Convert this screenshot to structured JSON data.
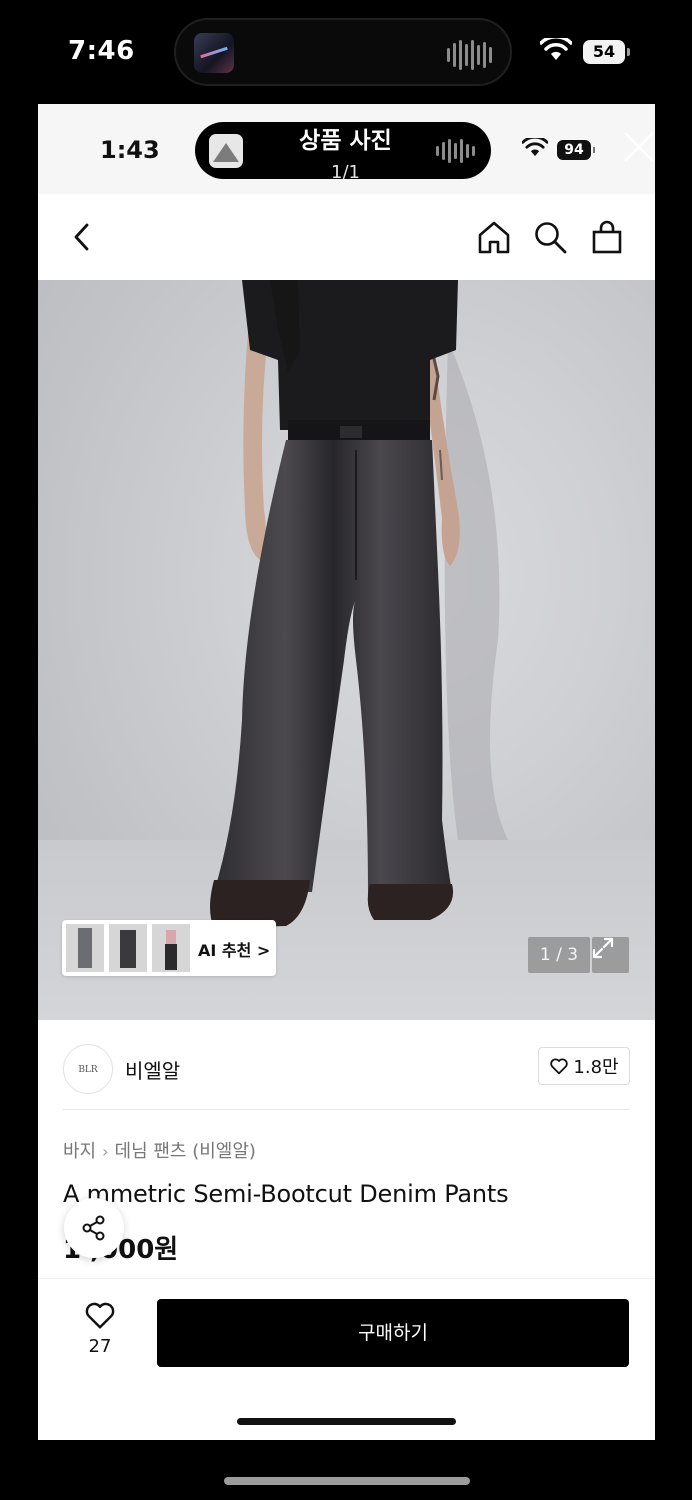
{
  "outer_status": {
    "time": "7:46",
    "battery": "54"
  },
  "inner_status": {
    "time": "1:43",
    "battery": "94"
  },
  "viewer": {
    "title": "상품 사진",
    "counter": "1/1"
  },
  "navbar": {
    "icons": [
      "back-icon",
      "home-icon",
      "search-icon",
      "shopping-bag-icon"
    ]
  },
  "image": {
    "ai_recommend_label": "AI 추천 >",
    "counter": "1 / 3"
  },
  "brand": {
    "logo_text": "BLR",
    "name": "비엘알",
    "likes": "1.8만"
  },
  "breadcrumb": {
    "category": "바지",
    "subcategory": "데님 팬츠 (비엘알)"
  },
  "product": {
    "name": "A  mmetric Semi-Bootcut Denim Pants",
    "price": "1  ,000원"
  },
  "bottom_bar": {
    "wish_count": "27",
    "buy_label": "구매하기"
  },
  "colors": {
    "buy_button": "#000000",
    "background": "#ffffff",
    "outer": "#000000"
  }
}
